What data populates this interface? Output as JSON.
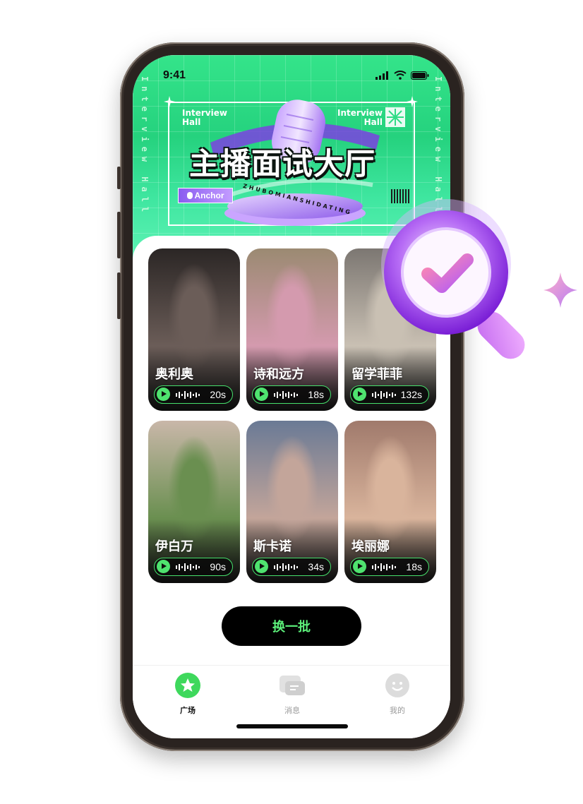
{
  "status_bar": {
    "time": "9:41"
  },
  "banner": {
    "side_text": "Interview Hall",
    "interview_hall_left": [
      "Interview",
      "Hall"
    ],
    "interview_hall_right": [
      "Interview",
      "Hall"
    ],
    "title": "主播面试大厅",
    "anchor_badge": "Anchor",
    "pinyin": "ZHUBOMIANSHIDATING"
  },
  "cards": [
    {
      "name": "奥利奥",
      "duration": "20s",
      "photo_colors": [
        "#2b2625",
        "#6b5d58"
      ]
    },
    {
      "name": "诗和远方",
      "duration": "18s",
      "photo_colors": [
        "#9b8a72",
        "#d49aae"
      ]
    },
    {
      "name": "留学菲菲",
      "duration": "132s",
      "photo_colors": [
        "#7c7772",
        "#c9c0b3"
      ]
    },
    {
      "name": "伊白万",
      "duration": "90s",
      "photo_colors": [
        "#c9b7a9",
        "#6a8f50"
      ]
    },
    {
      "name": "斯卡诺",
      "duration": "34s",
      "photo_colors": [
        "#6a7a95",
        "#c3a59a"
      ]
    },
    {
      "name": "埃丽娜",
      "duration": "18s",
      "photo_colors": [
        "#a07a6c",
        "#d9b49c"
      ]
    }
  ],
  "refresh_button": "换一批",
  "tabs": [
    {
      "label": "广场",
      "icon": "star-icon",
      "active": true
    },
    {
      "label": "消息",
      "icon": "message-icon",
      "active": false
    },
    {
      "label": "我的",
      "icon": "smile-icon",
      "active": false
    }
  ],
  "colors": {
    "accent_green": "#4fe36f",
    "hero_green": "#2fdc86",
    "purple": "#a855f7"
  }
}
